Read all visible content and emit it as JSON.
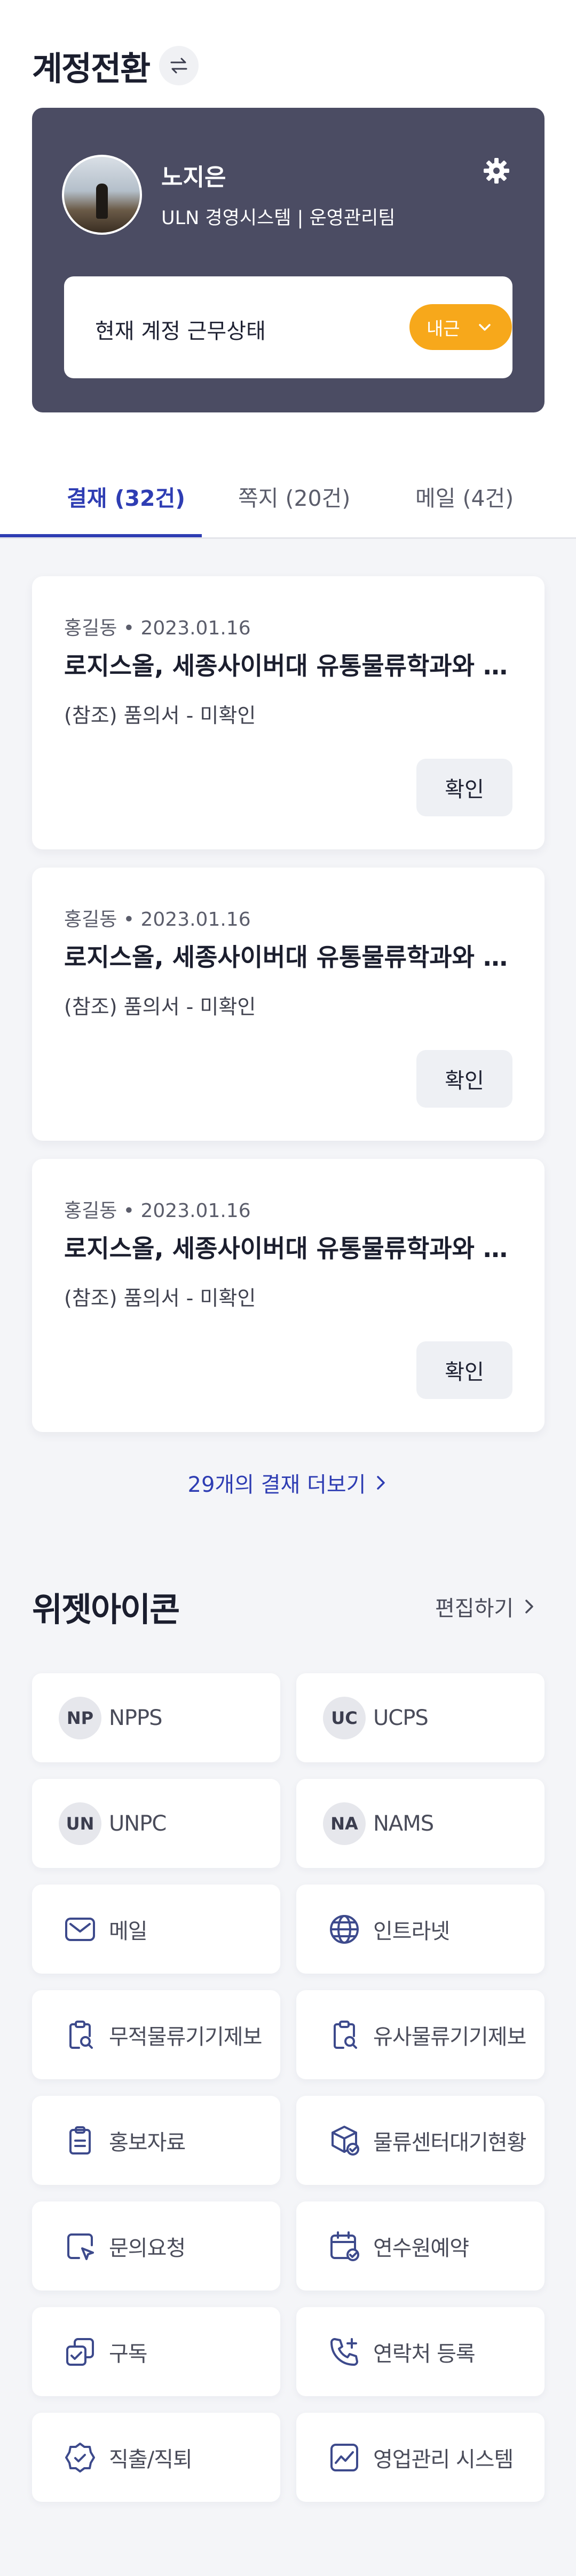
{
  "header": {
    "title": "계정전환"
  },
  "profile": {
    "name": "노지은",
    "org": "ULN 경영시스템 | 운영관리팀",
    "status_label": "현재 계정 근무상태",
    "status_value": "내근"
  },
  "tabs": [
    {
      "label": "결재 (32건)",
      "active": true
    },
    {
      "label": "쪽지 (20건)",
      "active": false
    },
    {
      "label": "메일 (4건)",
      "active": false
    }
  ],
  "approvals": [
    {
      "meta": "홍길동 • 2023.01.16",
      "subject": "로지스올, 세종사이버대 유통물류학과와 업무협약 체결",
      "desc": "(참조) 품의서 - 미확인",
      "button": "확인"
    },
    {
      "meta": "홍길동 • 2023.01.16",
      "subject": "로지스올, 세종사이버대 유통물류학과와 업무협약 체결",
      "desc": "(참조) 품의서 - 미확인",
      "button": "확인"
    },
    {
      "meta": "홍길동 • 2023.01.16",
      "subject": "로지스올, 세종사이버대 유통물류학과와 업무협약 체결",
      "desc": "(참조) 품의서 - 미확인",
      "button": "확인"
    }
  ],
  "more_label": "29개의 결재 더보기",
  "widgets": {
    "title": "위젯아이콘",
    "edit_label": "편집하기",
    "items": [
      {
        "badge": "NP",
        "label": "NPPS",
        "icon": "np-badge"
      },
      {
        "badge": "UC",
        "label": "UCPS",
        "icon": "uc-badge"
      },
      {
        "badge": "UN",
        "label": "UNPC",
        "icon": "un-badge"
      },
      {
        "badge": "NA",
        "label": "NAMS",
        "icon": "na-badge"
      },
      {
        "label": "메일",
        "icon": "mail-icon"
      },
      {
        "label": "인트라넷",
        "icon": "globe-icon"
      },
      {
        "label": "무적물류기기제보",
        "icon": "clipboard-search-icon"
      },
      {
        "label": "유사물류기기제보",
        "icon": "clipboard-search-icon"
      },
      {
        "label": "홍보자료",
        "icon": "clipboard-list-icon"
      },
      {
        "label": "물류센터대기현황",
        "icon": "box-check-icon"
      },
      {
        "label": "문의요청",
        "icon": "message-cursor-icon"
      },
      {
        "label": "연수원예약",
        "icon": "calendar-check-icon"
      },
      {
        "label": "구독",
        "icon": "copy-check-icon"
      },
      {
        "label": "연락처 등록",
        "icon": "phone-add-icon"
      },
      {
        "label": "직출/직퇴",
        "icon": "shield-check-icon"
      },
      {
        "label": "영업관리 시스템",
        "icon": "chart-line-icon"
      }
    ]
  },
  "colors": {
    "accent": "#2e3db3",
    "profile_bg": "#4b4c63",
    "status_pill": "#f7a81b",
    "icon_stroke": "#3d4a8c"
  }
}
